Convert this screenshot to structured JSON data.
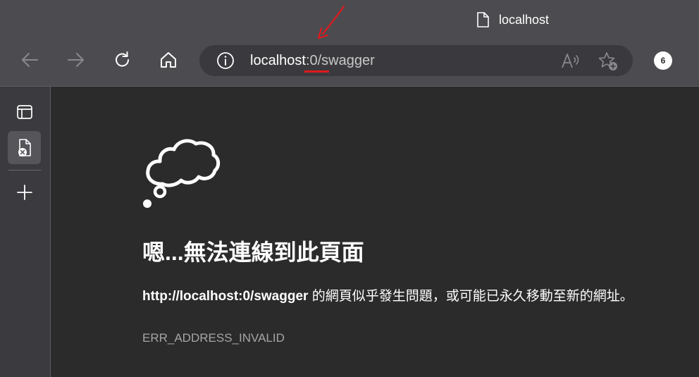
{
  "tab": {
    "title": "localhost",
    "icon": "page-icon"
  },
  "toolbar": {
    "back_icon": "arrow-left-icon",
    "forward_icon": "arrow-right-icon",
    "reload_icon": "refresh-icon",
    "home_icon": "home-icon"
  },
  "address": {
    "info_icon": "info-icon",
    "url_host": "localhost",
    "url_rest": ":0/swagger",
    "read_aloud_icon": "read-aloud-icon",
    "favorite_icon": "add-favorite-icon"
  },
  "profile": {
    "initials": "6"
  },
  "sidebar": {
    "items": [
      {
        "icon": "tab-actions-icon"
      },
      {
        "icon": "error-page-tab-icon"
      },
      {
        "icon": "new-tab-plus-icon"
      }
    ]
  },
  "error": {
    "heading": "嗯...無法連線到此頁面",
    "url": "http://localhost:0/swagger",
    "description": " 的網頁似乎發生問題，或可能已永久移動至新的網址。",
    "code": "ERR_ADDRESS_INVALID"
  },
  "colors": {
    "chrome": "#4c4c50",
    "content_bg": "#2b2b2b",
    "annotation_red": "#e0191b"
  }
}
